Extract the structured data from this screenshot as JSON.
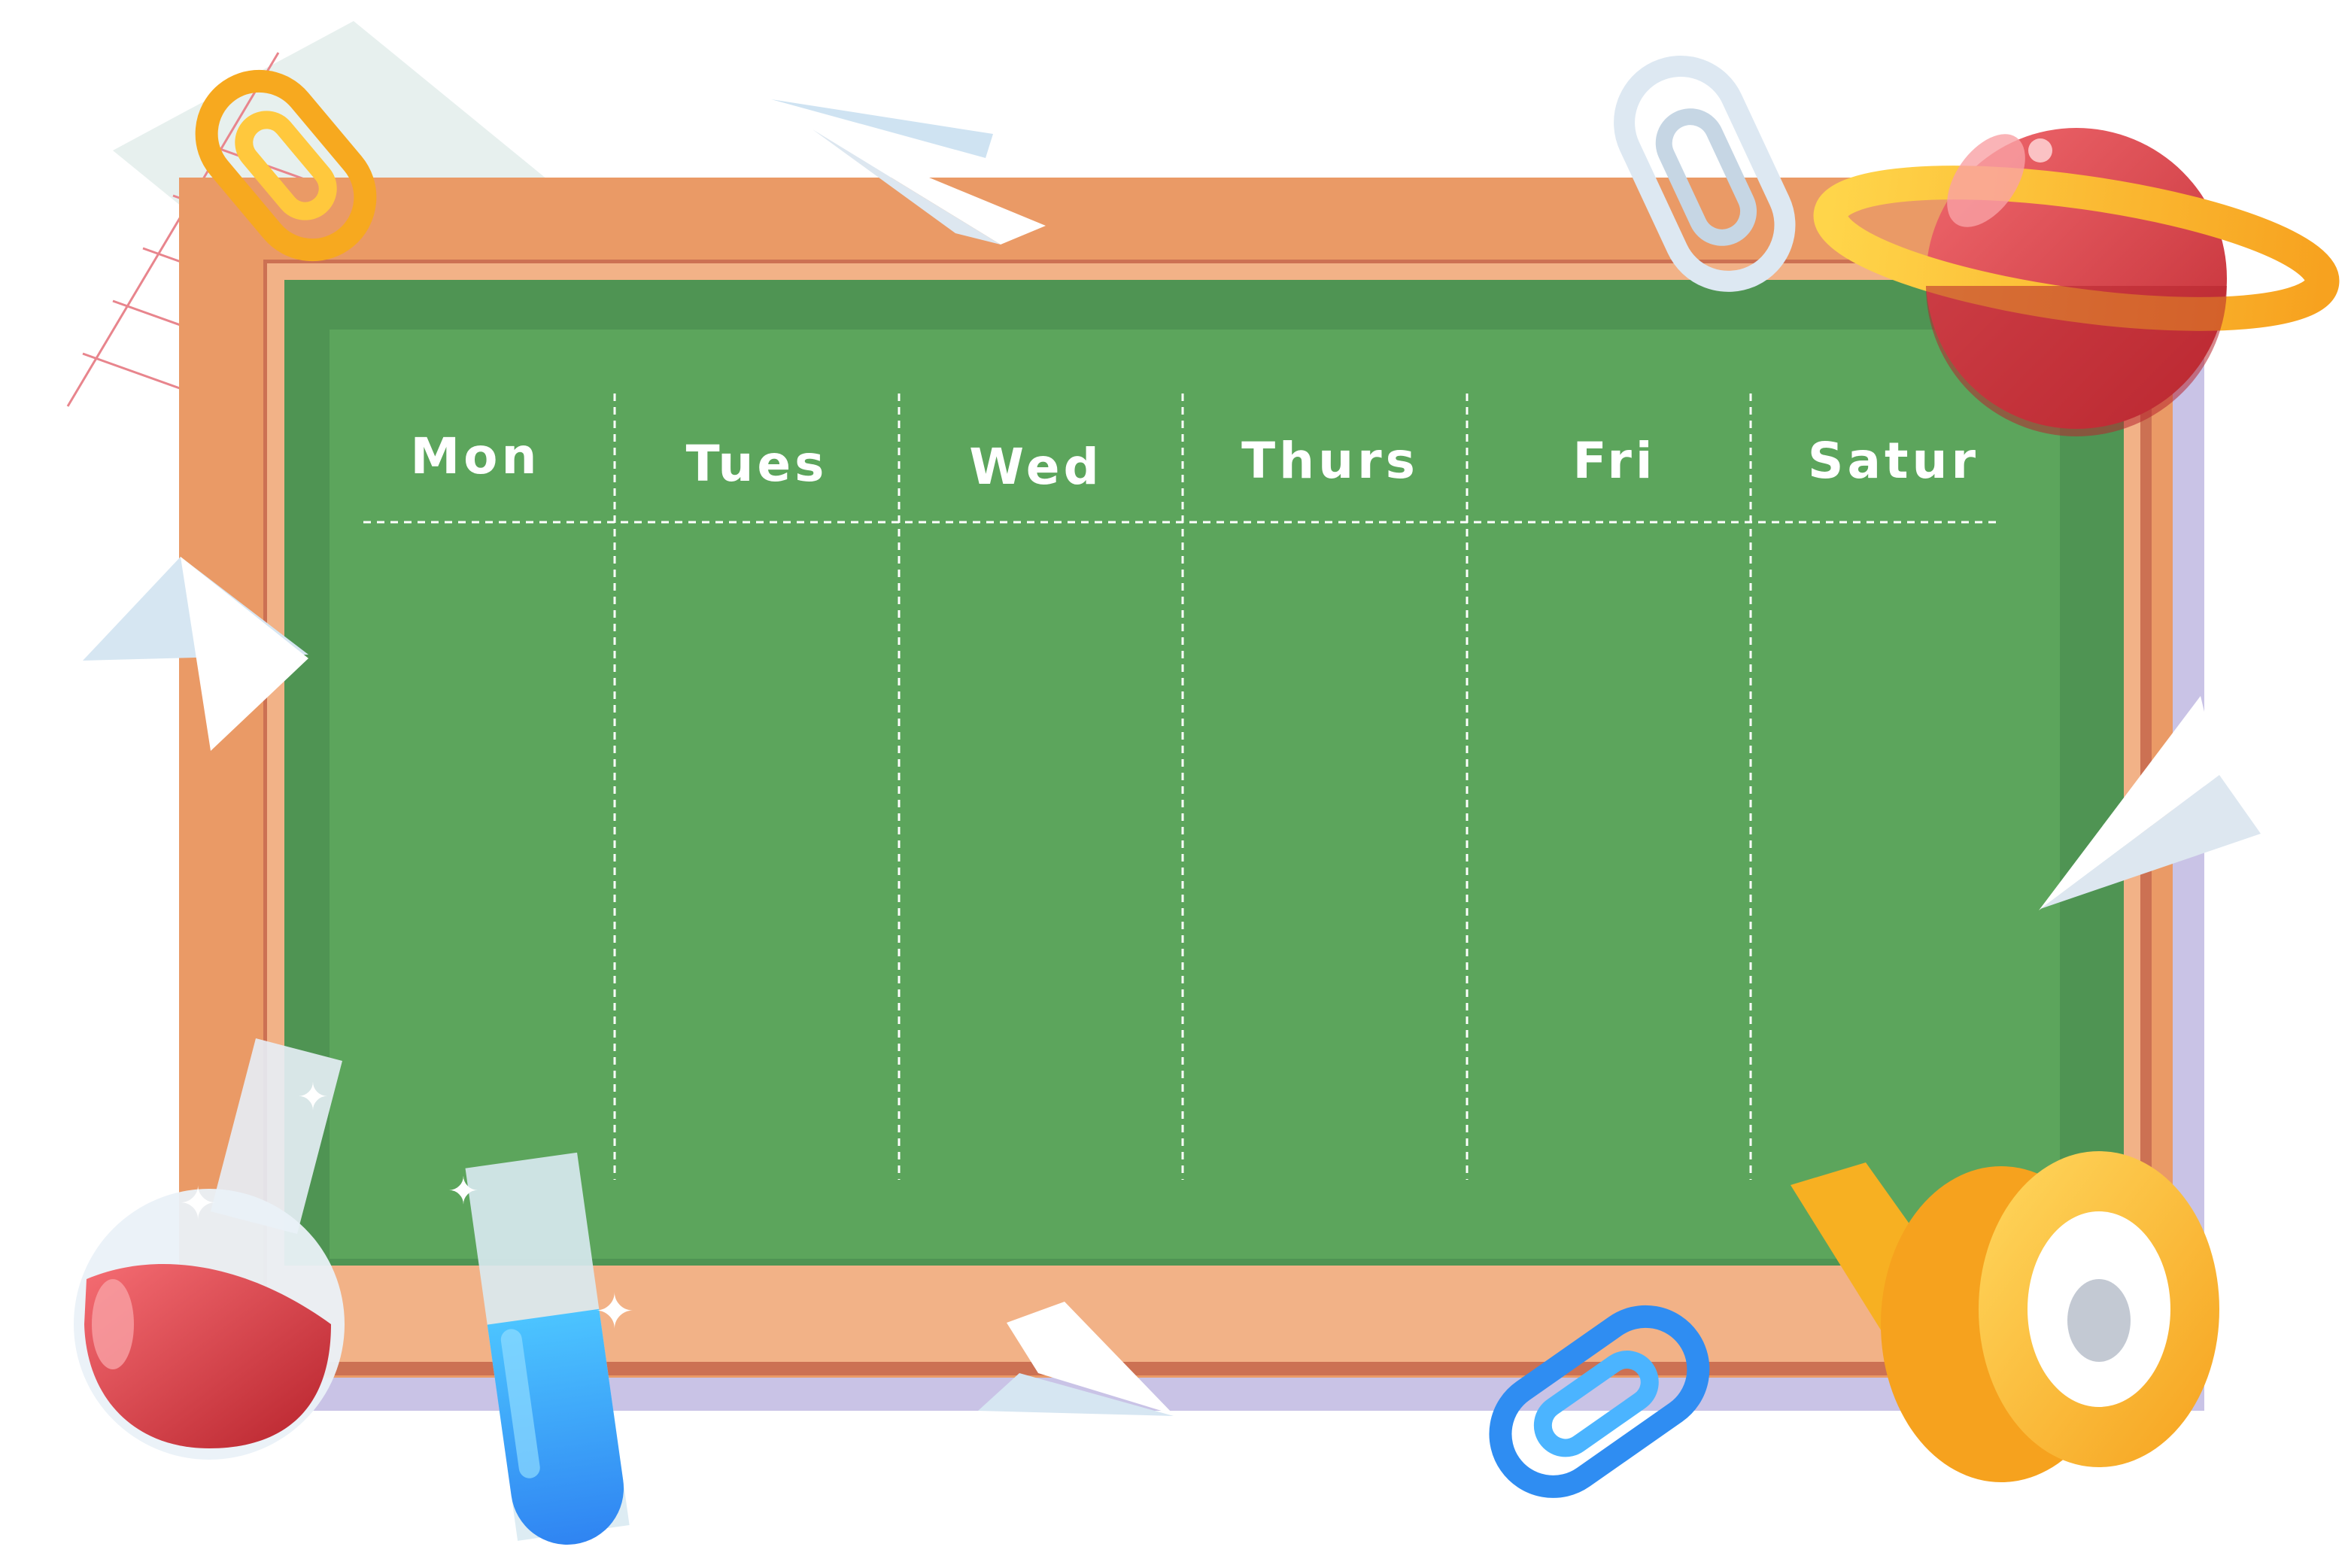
{
  "timetable": {
    "days": [
      "Mon",
      "Tues",
      "Wed",
      "Thurs",
      "Fri",
      "Satur"
    ]
  },
  "colors": {
    "frame": "#EA9A66",
    "frame_dark": "#CC7153",
    "board": "#5CA55C",
    "board_dark": "#4F9453",
    "shadow": "#C9C3E6",
    "chalk": "#FFFFFF"
  }
}
